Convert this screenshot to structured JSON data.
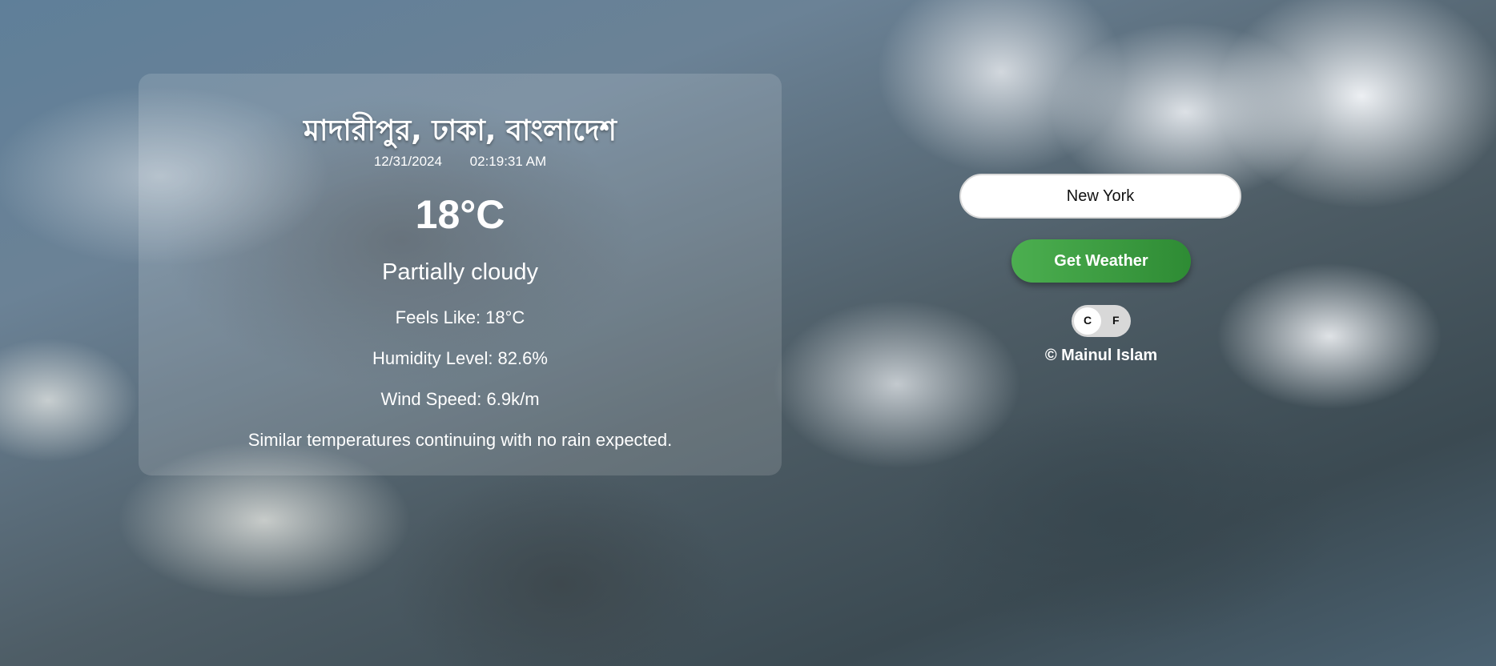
{
  "weather": {
    "location": "মাদারীপুর, ঢাকা, বাংলাদেশ",
    "date": "12/31/2024",
    "time": "02:19:31 AM",
    "temperature": "18°C",
    "condition": "Partially cloudy",
    "feels_like": "Feels Like: 18°C",
    "humidity": "Humidity Level: 82.6%",
    "wind": "Wind Speed: 6.9k/m",
    "forecast": "Similar temperatures continuing with no rain expected."
  },
  "controls": {
    "search_value": "New York",
    "button_label": "Get Weather",
    "unit_c": "C",
    "unit_f": "F",
    "selected_unit": "C",
    "credit": "© Mainul Islam"
  },
  "colors": {
    "button_start": "#4caf50",
    "button_end": "#2e8b34",
    "text": "#ffffff"
  }
}
